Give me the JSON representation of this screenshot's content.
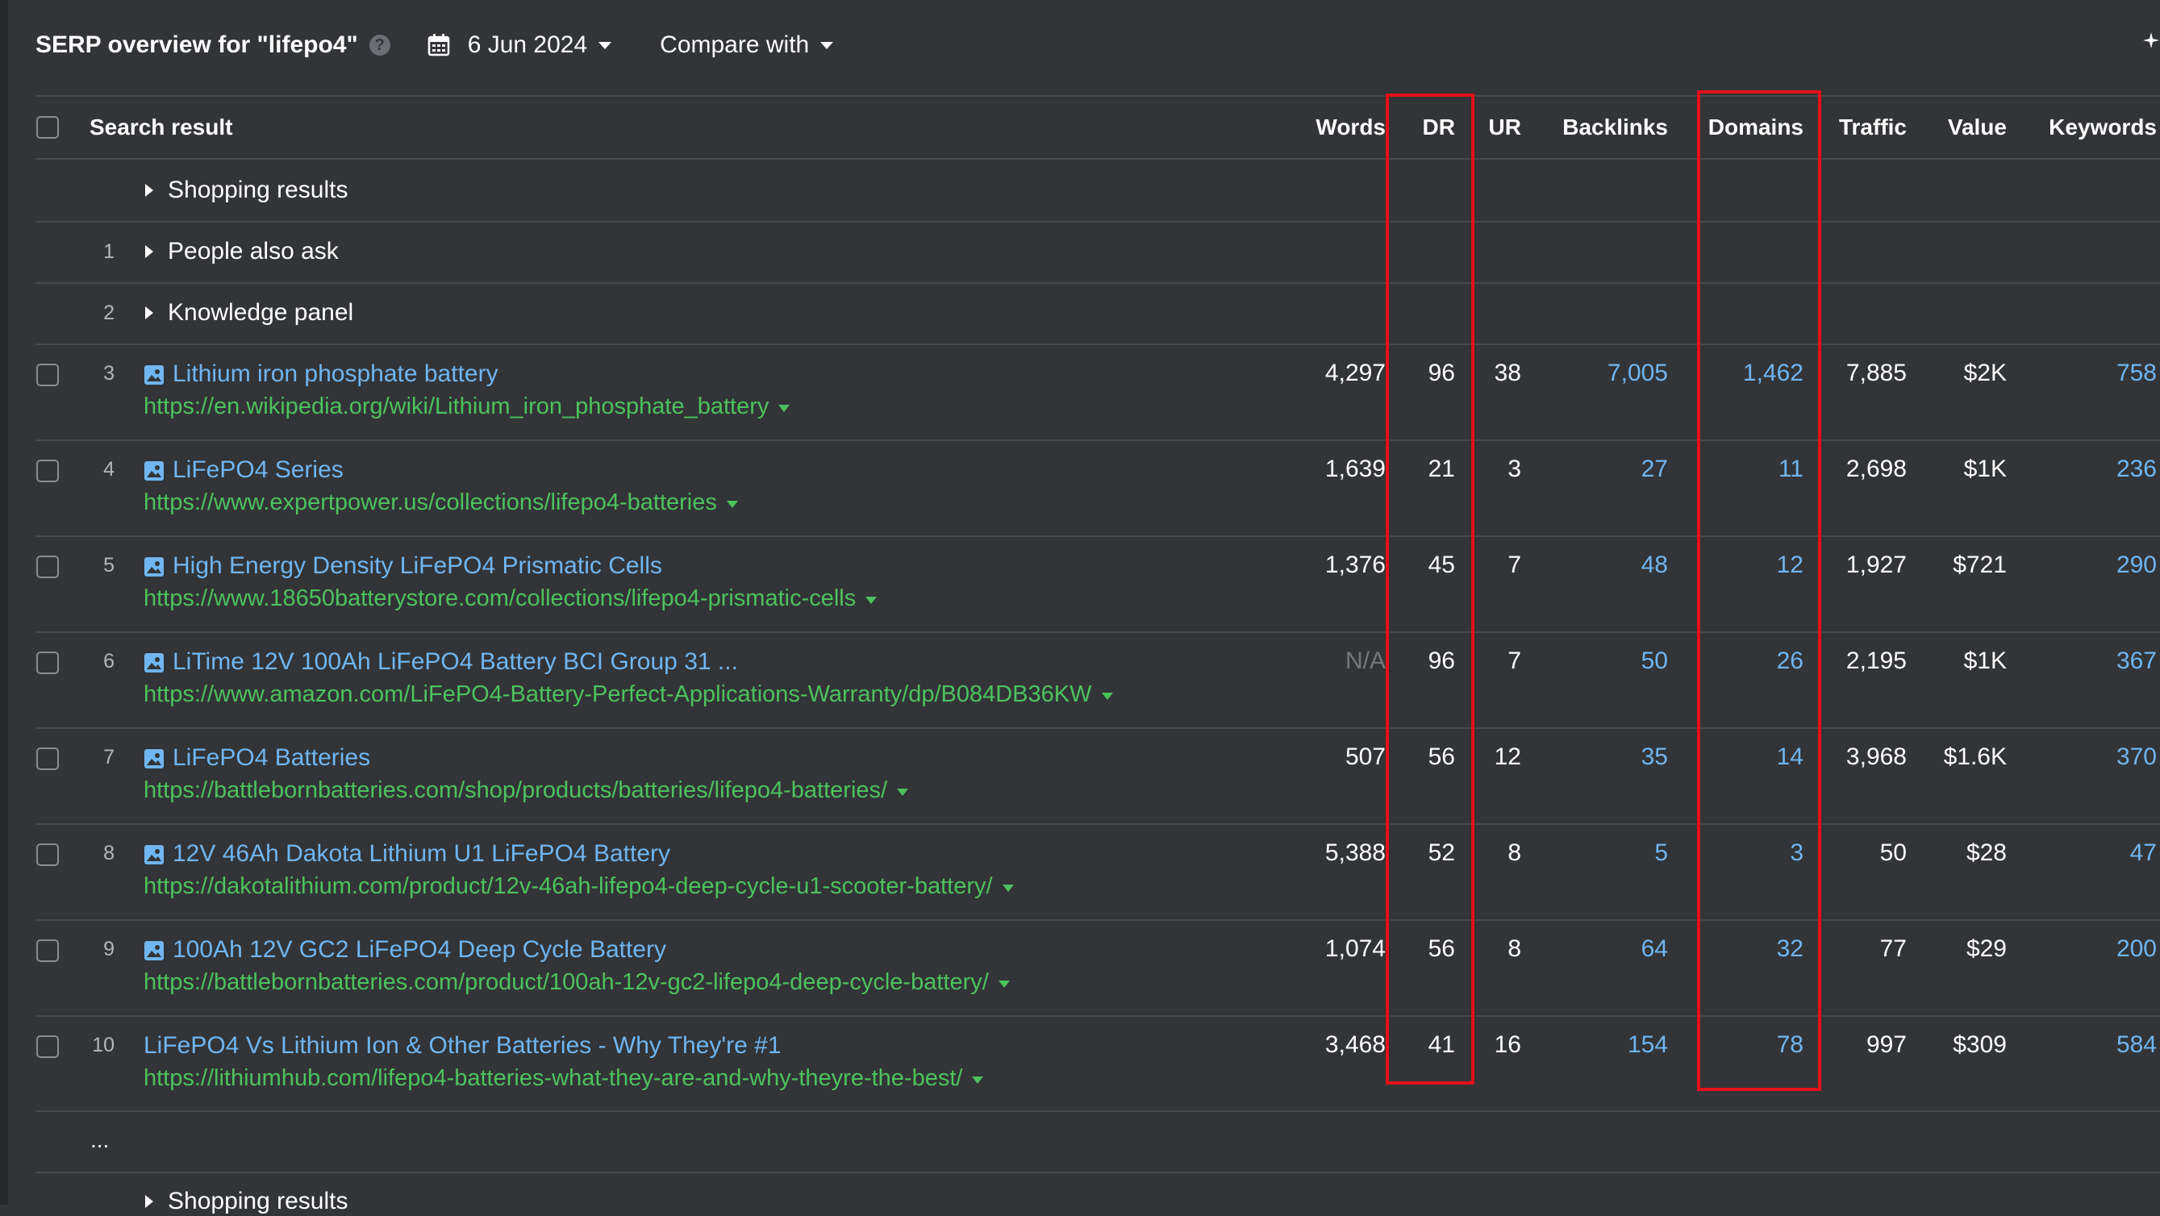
{
  "header": {
    "title": "SERP overview for \"lifepo4\"",
    "help_icon": "?",
    "date": "6 Jun 2024",
    "compare_label": "Compare with"
  },
  "columns": {
    "search_result": "Search result",
    "words": "Words",
    "dr": "DR",
    "ur": "UR",
    "backlinks": "Backlinks",
    "domains": "Domains",
    "traffic": "Traffic",
    "value": "Value",
    "keywords": "Keywords"
  },
  "sections": {
    "shopping_top": "Shopping results",
    "people_also_ask": {
      "rank": "1",
      "label": "People also ask"
    },
    "knowledge_panel": {
      "rank": "2",
      "label": "Knowledge panel"
    },
    "ellipsis": "...",
    "shopping_bottom": "Shopping results"
  },
  "results": [
    {
      "rank": "3",
      "title": "Lithium iron phosphate battery",
      "url": "https://en.wikipedia.org/wiki/Lithium_iron_phosphate_battery",
      "words": "4,297",
      "dr": "96",
      "ur": "38",
      "backlinks": "7,005",
      "domains": "1,462",
      "traffic": "7,885",
      "value": "$2K",
      "keywords": "758",
      "image_icon": true
    },
    {
      "rank": "4",
      "title": "LiFePO4 Series",
      "url": "https://www.expertpower.us/collections/lifepo4-batteries",
      "words": "1,639",
      "dr": "21",
      "ur": "3",
      "backlinks": "27",
      "domains": "11",
      "traffic": "2,698",
      "value": "$1K",
      "keywords": "236",
      "image_icon": true
    },
    {
      "rank": "5",
      "title": "High Energy Density LiFePO4 Prismatic Cells",
      "url": "https://www.18650batterystore.com/collections/lifepo4-prismatic-cells",
      "words": "1,376",
      "dr": "45",
      "ur": "7",
      "backlinks": "48",
      "domains": "12",
      "traffic": "1,927",
      "value": "$721",
      "keywords": "290",
      "image_icon": true
    },
    {
      "rank": "6",
      "title": "LiTime 12V 100Ah LiFePO4 Battery BCI Group 31 ...",
      "url": "https://www.amazon.com/LiFePO4-Battery-Perfect-Applications-Warranty/dp/B084DB36KW",
      "words": "N/A",
      "dr": "96",
      "ur": "7",
      "backlinks": "50",
      "domains": "26",
      "traffic": "2,195",
      "value": "$1K",
      "keywords": "367",
      "image_icon": true
    },
    {
      "rank": "7",
      "title": "LiFePO4 Batteries",
      "url": "https://battlebornbatteries.com/shop/products/batteries/lifepo4-batteries/",
      "words": "507",
      "dr": "56",
      "ur": "12",
      "backlinks": "35",
      "domains": "14",
      "traffic": "3,968",
      "value": "$1.6K",
      "keywords": "370",
      "image_icon": true
    },
    {
      "rank": "8",
      "title": "12V 46Ah Dakota Lithium U1 LiFePO4 Battery",
      "url": "https://dakotalithium.com/product/12v-46ah-lifepo4-deep-cycle-u1-scooter-battery/",
      "words": "5,388",
      "dr": "52",
      "ur": "8",
      "backlinks": "5",
      "domains": "3",
      "traffic": "50",
      "value": "$28",
      "keywords": "47",
      "image_icon": true
    },
    {
      "rank": "9",
      "title": "100Ah 12V GC2 LiFePO4 Deep Cycle Battery",
      "url": "https://battlebornbatteries.com/product/100ah-12v-gc2-lifepo4-deep-cycle-battery/",
      "words": "1,074",
      "dr": "56",
      "ur": "8",
      "backlinks": "64",
      "domains": "32",
      "traffic": "77",
      "value": "$29",
      "keywords": "200",
      "image_icon": true
    },
    {
      "rank": "10",
      "title": "LiFePO4 Vs Lithium Ion & Other Batteries - Why They're #1",
      "url": "https://lithiumhub.com/lifepo4-batteries-what-they-are-and-why-theyre-the-best/",
      "words": "3,468",
      "dr": "41",
      "ur": "16",
      "backlinks": "154",
      "domains": "78",
      "traffic": "997",
      "value": "$309",
      "keywords": "584",
      "image_icon": false
    }
  ],
  "colors": {
    "background": "#323437",
    "link": "#6fb6f2",
    "url": "#4cc35d",
    "highlight": "#e3101a"
  }
}
